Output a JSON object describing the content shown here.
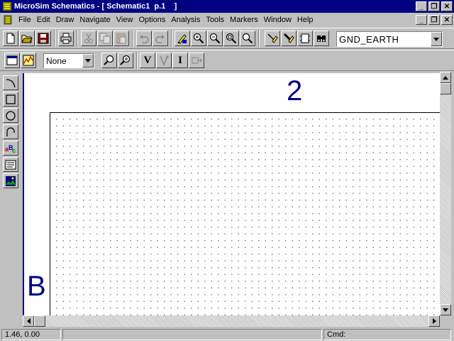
{
  "window": {
    "title": "MicroSim Schematics - [ Schematic1  p.1    ]",
    "buttons": {
      "minimize": "_",
      "maximize": "❐",
      "close": "✕"
    }
  },
  "menubar": {
    "items": [
      {
        "label": "File"
      },
      {
        "label": "Edit"
      },
      {
        "label": "Draw"
      },
      {
        "label": "Navigate"
      },
      {
        "label": "View"
      },
      {
        "label": "Options"
      },
      {
        "label": "Analysis"
      },
      {
        "label": "Tools"
      },
      {
        "label": "Markers"
      },
      {
        "label": "Window"
      },
      {
        "label": "Help"
      }
    ]
  },
  "toolbar": {
    "part_combo_value": "GND_EARTH"
  },
  "toolbar2": {
    "display_combo_value": "None",
    "v_label": "V",
    "i_label": "I"
  },
  "canvas": {
    "zone_top": "2",
    "zone_left": "B"
  },
  "statusbar": {
    "coords": " 1.46,  0.00",
    "message": "",
    "cmd": "Cmd:"
  },
  "colors": {
    "titlebar": "#000080",
    "face": "#c0c0c0",
    "canvas": "#ffffff",
    "zone_text": "#000080"
  }
}
